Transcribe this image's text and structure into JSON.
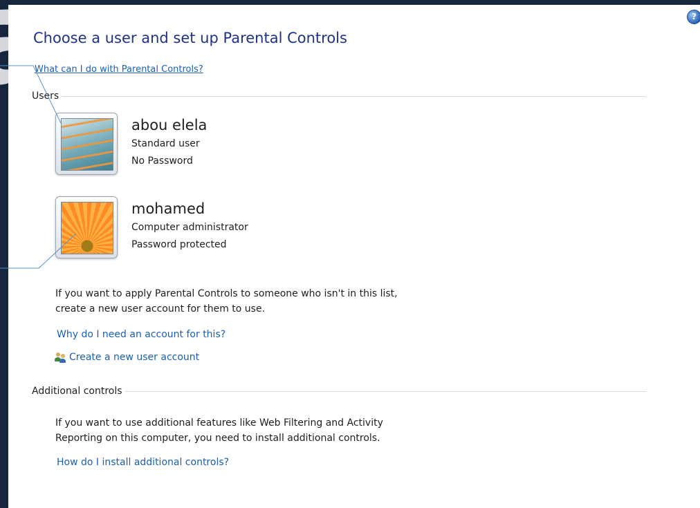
{
  "page": {
    "title": "Choose a user and set up Parental Controls",
    "help_link": "What can I do with Parental Controls?",
    "help_icon_glyph": "?"
  },
  "users_section": {
    "header": "Users",
    "users": [
      {
        "name": "abou elela",
        "type": "Standard user",
        "password_status": "No Password",
        "avatar": "staircase-picture"
      },
      {
        "name": "mohamed",
        "type": "Computer administrator",
        "password_status": "Password protected",
        "avatar": "orange-flower-picture"
      }
    ],
    "info_line1": "If you want to apply Parental Controls to someone who isn't in this list,",
    "info_line2": "create a new user account for them to use.",
    "why_link": "Why do I need an account for this?",
    "create_link": "Create a new user account"
  },
  "additional_section": {
    "header": "Additional controls",
    "info_line1": "If you want to use additional features like Web Filtering and Activity",
    "info_line2": "Reporting on this computer, you need to install additional controls.",
    "install_link": "How do I install additional controls?"
  },
  "colors": {
    "title": "#1e3287",
    "link": "#1a5fb4",
    "background": "#16263d",
    "panel": "#ffffff"
  }
}
